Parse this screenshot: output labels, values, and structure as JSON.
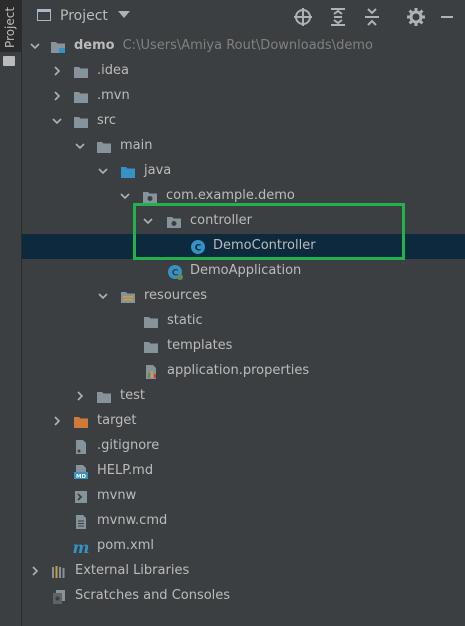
{
  "sidebar": {
    "tab_label": "Project"
  },
  "header": {
    "title": "Project"
  },
  "tree": {
    "root": {
      "label": "demo",
      "path": "C:\\Users\\Amiya Rout\\Downloads\\demo"
    },
    "idea": ".idea",
    "mvn": ".mvn",
    "src": "src",
    "main": "main",
    "java": "java",
    "package": "com.example.demo",
    "controller": "controller",
    "demo_controller": "DemoController",
    "demo_application": "DemoApplication",
    "resources": "resources",
    "static": "static",
    "templates": "templates",
    "app_props": "application.properties",
    "test": "test",
    "target": "target",
    "gitignore": ".gitignore",
    "help": "HELP.md",
    "mvnw": "mvnw",
    "mvnw_cmd": "mvnw.cmd",
    "pom": "pom.xml",
    "external_libraries": "External Libraries",
    "scratches": "Scratches and Consoles"
  },
  "colors": {
    "background": "#3c3f41",
    "selection": "#0d293e",
    "highlight_border": "#22b14c",
    "folder": "#87939a",
    "source_folder": "#3592c4",
    "excluded_folder": "#d07a3a",
    "class_icon": "#3592c4"
  }
}
